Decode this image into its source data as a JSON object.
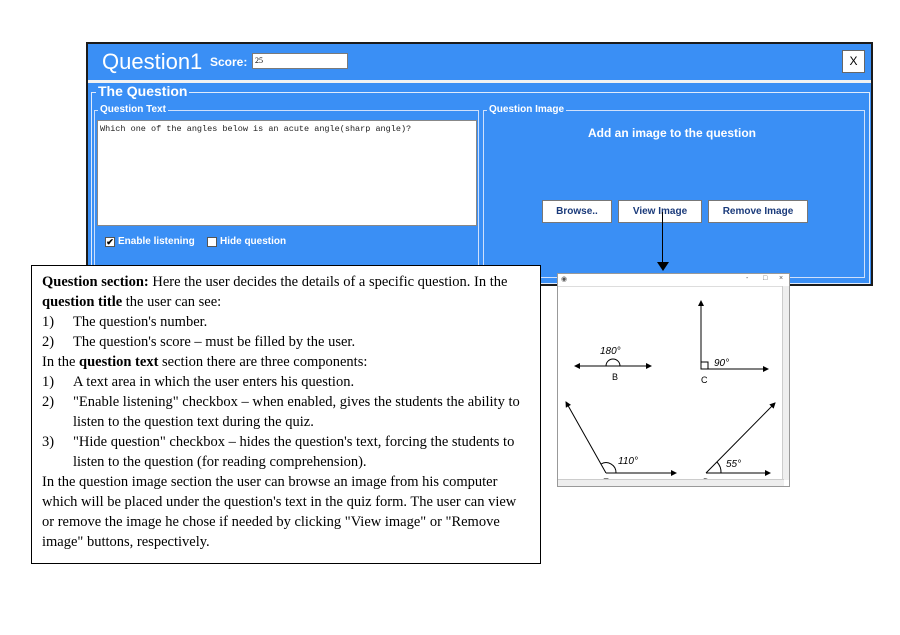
{
  "window": {
    "title": "Question1",
    "score_label": "Score:",
    "score_value": "25",
    "close_label": "X"
  },
  "question_panel": {
    "legend": "The Question",
    "text_legend": "Question Text",
    "question_text": "Which one of the angles below is an acute angle(sharp angle)?",
    "enable_listening_label": "Enable listening",
    "enable_listening_checked": "✔",
    "hide_question_label": "Hide question",
    "image_legend": "Question Image",
    "add_image_prompt": "Add an image to the question",
    "browse_label": "Browse..",
    "view_image_label": "View Image",
    "remove_image_label": "Remove Image"
  },
  "image_window": {
    "controls": [
      "-",
      "□",
      "×"
    ],
    "angles": [
      {
        "value": "180°",
        "letter": "B"
      },
      {
        "value": "90°",
        "letter": "C"
      },
      {
        "value": "110°",
        "letter": "E"
      },
      {
        "value": "55°",
        "letter": "D"
      }
    ]
  },
  "description": {
    "intro_bold": "Question section:",
    "intro_rest": " Here the user decides the details of a specific question. In the ",
    "title_bold": "question title",
    "title_rest": " the user can see:",
    "title_items": [
      {
        "num": "1)",
        "text": "The question's number."
      },
      {
        "num": "2)",
        "text": "The question's score – must be filled by the user."
      }
    ],
    "text_intro_a": "In the ",
    "text_bold": "question text",
    "text_intro_b": " section there are three components:",
    "text_items": [
      {
        "num": "1)",
        "text": "A text area in which the user enters his question."
      },
      {
        "num": "2)",
        "text": "\"Enable listening\" checkbox – when enabled, gives the students the ability to listen to the question text during the quiz."
      },
      {
        "num": "3)",
        "text": "\"Hide question\" checkbox – hides the question's text, forcing the students to listen to the question (for reading comprehension)."
      }
    ],
    "image_paragraph": "In the question image section the user can browse an image from his computer which will be placed under the question's text in the quiz form. The user can view or remove the image he chose if needed by clicking \"View image\" or \"Remove image\" buttons, respectively."
  }
}
